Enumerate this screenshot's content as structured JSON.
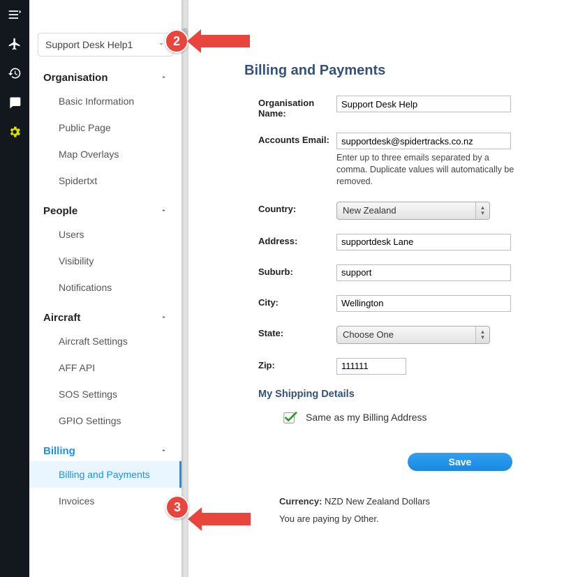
{
  "orgSelect": "Support Desk Help1",
  "nav": {
    "orgHeader": "Organisation",
    "orgItems": [
      "Basic Information",
      "Public Page",
      "Map Overlays",
      "Spidertxt"
    ],
    "peopleHeader": "People",
    "peopleItems": [
      "Users",
      "Visibility",
      "Notifications"
    ],
    "aircraftHeader": "Aircraft",
    "aircraftItems": [
      "Aircraft Settings",
      "AFF API",
      "SOS Settings",
      "GPIO Settings"
    ],
    "billingHeader": "Billing",
    "billingItems": [
      "Billing and Payments",
      "Invoices"
    ]
  },
  "page": {
    "title": "Billing and Payments",
    "labels": {
      "orgName": "Organisation Name:",
      "email": "Accounts Email:",
      "emailHint": "Enter up to three emails separated by a comma. Duplicate values will automatically be removed.",
      "country": "Country:",
      "address": "Address:",
      "suburb": "Suburb:",
      "city": "City:",
      "state": "State:",
      "zip": "Zip:",
      "shipping": "My Shipping Details",
      "sameAs": "Same as my Billing Address",
      "save": "Save",
      "currencyLabel": "Currency:",
      "paying": "You are paying by Other."
    },
    "values": {
      "orgName": "Support Desk Help",
      "email": "supportdesk@spidertracks.co.nz",
      "country": "New Zealand",
      "address": "supportdesk Lane",
      "suburb": "support",
      "city": "Wellington",
      "state": "Choose One",
      "zip": "111111",
      "currency": "NZD New Zealand Dollars"
    }
  },
  "callouts": {
    "two": "2",
    "three": "3"
  }
}
